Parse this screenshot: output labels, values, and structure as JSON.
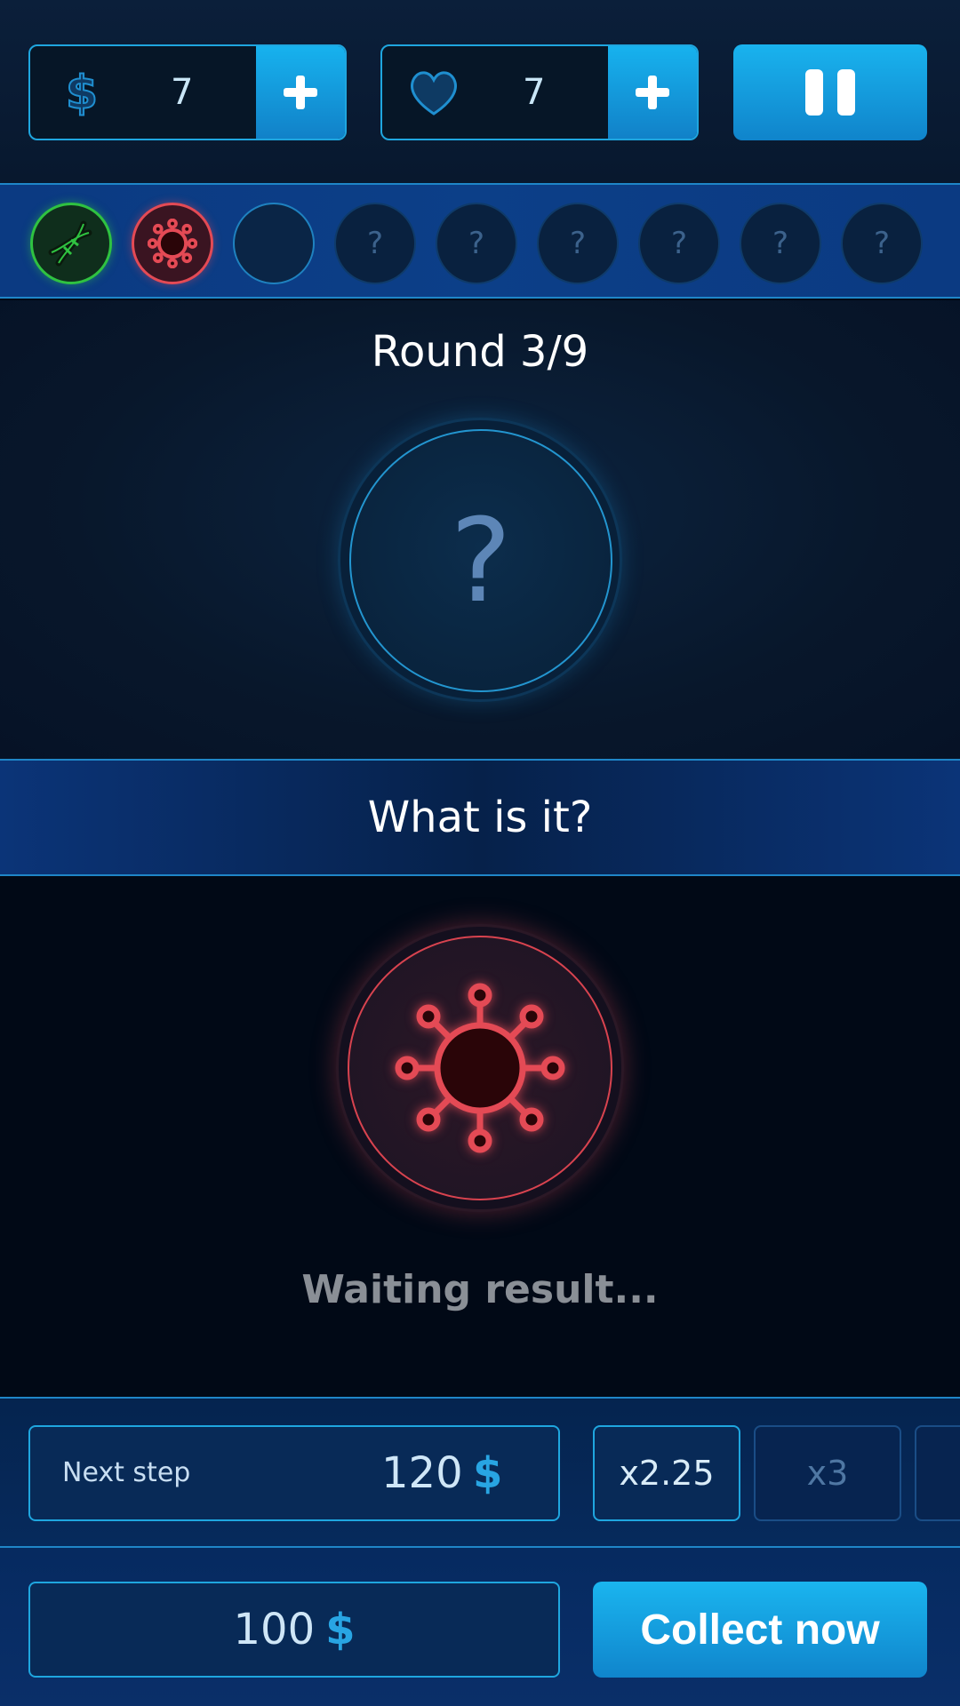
{
  "top_bar": {
    "coins": {
      "icon": "dollar-icon",
      "value": "7",
      "add_icon": "plus-icon"
    },
    "lives": {
      "icon": "heart-icon",
      "value": "7",
      "add_icon": "plus-icon"
    },
    "pause_icon": "pause-icon"
  },
  "progress": {
    "steps": [
      {
        "state": "won",
        "icon": "dna-icon",
        "color": "#2fc241"
      },
      {
        "state": "lost",
        "icon": "virus-icon",
        "color": "#e44a55"
      },
      {
        "state": "current",
        "label": ""
      },
      {
        "state": "locked",
        "label": "?"
      },
      {
        "state": "locked",
        "label": "?"
      },
      {
        "state": "locked",
        "label": "?"
      },
      {
        "state": "locked",
        "label": "?"
      },
      {
        "state": "locked",
        "label": "?"
      },
      {
        "state": "locked",
        "label": "?"
      }
    ]
  },
  "round": {
    "title": "Round 3/9",
    "mystery_label": "?"
  },
  "question": "What is it?",
  "result": {
    "icon": "virus-icon",
    "status": "Waiting result..."
  },
  "next_step": {
    "label": "Next step",
    "amount": "120",
    "currency": "$"
  },
  "multipliers": [
    {
      "label": "x2.25",
      "active": true
    },
    {
      "label": "x3",
      "active": false
    },
    {
      "label": "",
      "active": false
    }
  ],
  "bank": {
    "amount": "100",
    "currency": "$"
  },
  "collect_button": "Collect now",
  "colors": {
    "accent": "#1fa6df",
    "button": "#17b2ee",
    "won": "#2fc241",
    "lost": "#e44a55"
  }
}
